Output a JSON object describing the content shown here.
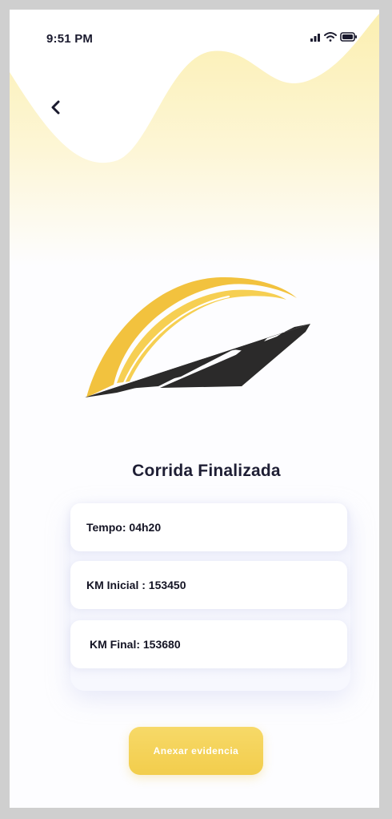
{
  "status_bar": {
    "time": "9:51 PM",
    "icons": [
      "signal-icon",
      "wifi-icon",
      "battery-icon"
    ]
  },
  "header": {
    "back_icon": "chevron-left-icon"
  },
  "logo": {
    "icon": "road-logo-icon",
    "colors": {
      "arc": "#f2c23e",
      "road": "#2b2a2a"
    }
  },
  "main": {
    "title": "Corrida Finalizada",
    "cards": [
      {
        "label": "Tempo: 04h20"
      },
      {
        "label": "KM Inicial : 153450"
      },
      {
        "label": "KM Final: 153680"
      }
    ]
  },
  "action": {
    "label": "Anexar evidencia",
    "color": "#f4d257"
  },
  "theme": {
    "accent": "#f4d257",
    "wave": "#fbeeaa",
    "background": "#fdfdff",
    "text": "#1e1e34"
  }
}
